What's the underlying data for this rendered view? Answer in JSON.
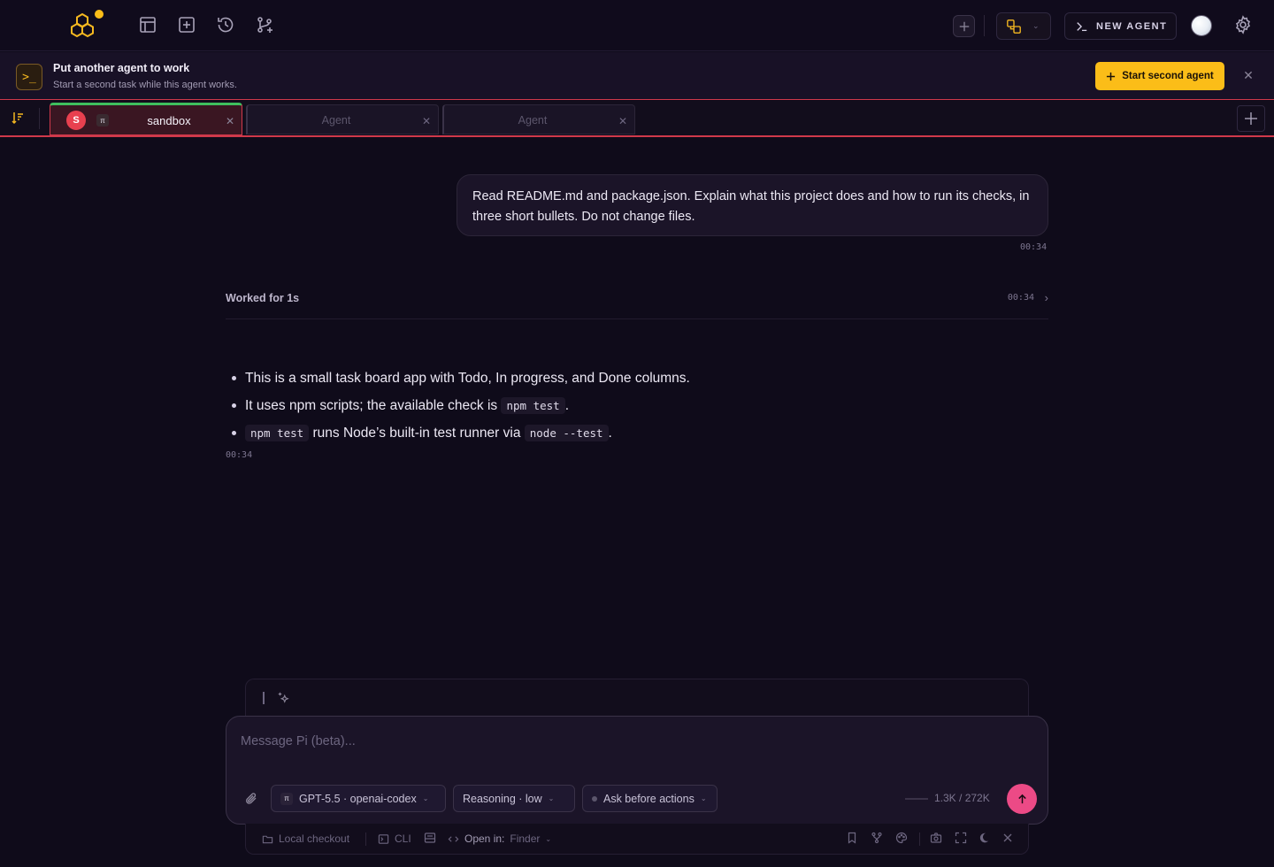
{
  "header": {
    "new_agent_label": "NEW AGENT",
    "icons": [
      "app-logo",
      "layout-icon",
      "add-square-icon",
      "history-icon",
      "branch-icon",
      "plus-icon",
      "switch-icon",
      "terminal-icon",
      "avatar",
      "gear-icon"
    ]
  },
  "banner": {
    "title": "Put another agent to work",
    "subtitle": "Start a second task while this agent works.",
    "button_label": "Start second agent"
  },
  "tabs": [
    {
      "avatar_letter": "S",
      "badge": "π",
      "label": "sandbox",
      "active": true
    },
    {
      "label": "Agent",
      "active": false
    },
    {
      "label": "Agent",
      "active": false
    }
  ],
  "chat": {
    "user_message": "Read README.md and package.json. Explain what this project does and how to run its checks, in three short bullets. Do not change files.",
    "user_time": "00:34",
    "worked_label": "Worked for 1s",
    "worked_time": "00:34",
    "answer": {
      "b1": "This is a small task board app with Todo, In progress, and Done columns.",
      "b2_pre": "It uses npm scripts; the available check is ",
      "b2_code": "npm test",
      "b2_post": ".",
      "b3_code1": "npm test",
      "b3_mid": " runs Node’s built-in test runner via ",
      "b3_code2": "node --test",
      "b3_post": "."
    },
    "answer_time": "00:34"
  },
  "composer": {
    "placeholder": "Message Pi (beta)...",
    "model_badge": "π",
    "model_label": "GPT-5.5 · openai-codex",
    "reasoning_label": "Reasoning · low",
    "approval_label": "Ask before actions",
    "context_usage": "1.3K / 272K"
  },
  "footer": {
    "checkout_label": "Local checkout",
    "cli_label": "CLI",
    "open_in_label": "Open in:",
    "open_in_value": "Finder"
  },
  "colors": {
    "accent": "#fbbd18",
    "danger": "#d0394b",
    "send": "#ec4a86",
    "tab_indicator": "#3fbf5e"
  }
}
